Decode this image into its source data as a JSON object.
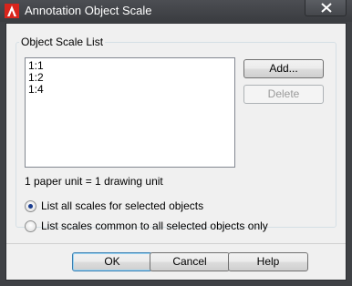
{
  "window": {
    "title": "Annotation Object Scale"
  },
  "group": {
    "label": "Object Scale List"
  },
  "scale_list": {
    "items": [
      "1:1",
      "1:2",
      "1:4"
    ]
  },
  "buttons": {
    "add": "Add...",
    "delete": "Delete",
    "ok": "OK",
    "cancel": "Cancel",
    "help": "Help"
  },
  "unit_text": "1 paper unit = 1 drawing unit",
  "radio_options": [
    {
      "label": "List all scales for selected objects",
      "selected": true
    },
    {
      "label": "List scales common to all selected objects only",
      "selected": false
    }
  ],
  "colors": {
    "title_bar": "#3f4145",
    "app_icon_red": "#d9251c",
    "client_bg": "#f0f0f0"
  },
  "icons": {
    "app": "autocad-a-icon",
    "close": "close-x-icon"
  }
}
